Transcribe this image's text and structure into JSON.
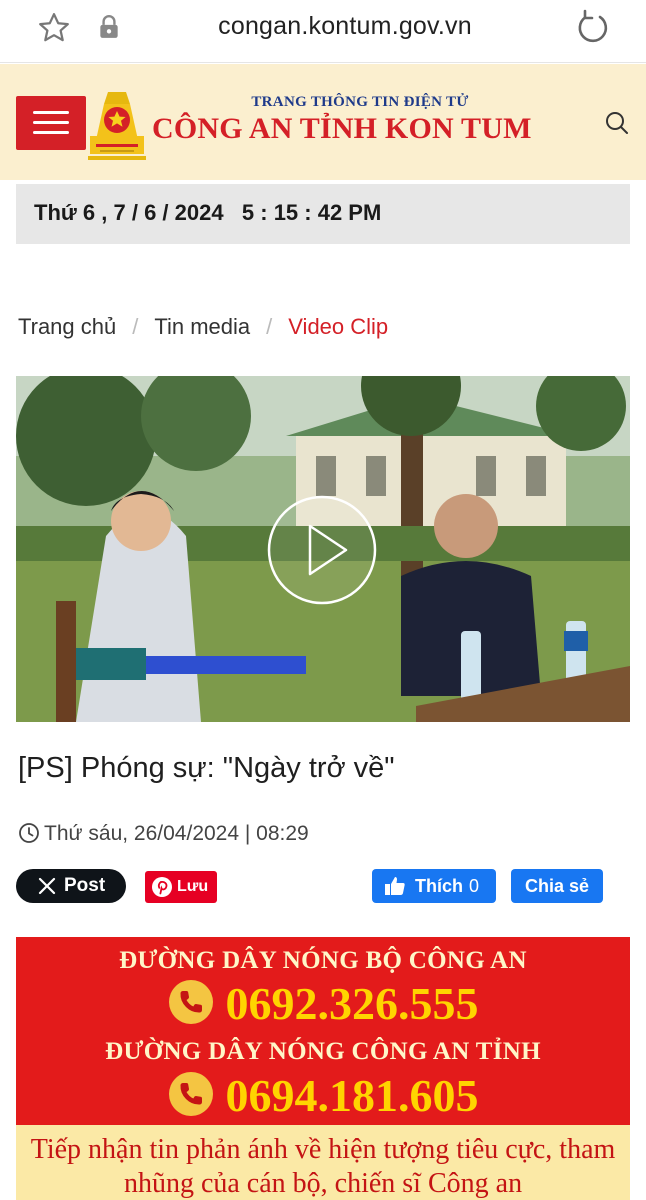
{
  "browser": {
    "url": "congan.kontum.gov.vn"
  },
  "header": {
    "subtitle": "TRANG THÔNG TIN ĐIỆN TỬ",
    "title": "CÔNG AN TỈNH KON TUM"
  },
  "datebar": {
    "datetime": "Thứ 6 , 7 / 6 / 2024   5 : 15 : 42 PM"
  },
  "breadcrumb": {
    "home": "Trang chủ",
    "section": "Tin media",
    "current": "Video Clip"
  },
  "article": {
    "title": "[PS] Phóng sự: \"Ngày trở về\"",
    "published": "Thứ sáu, 26/04/2024 | 08:29"
  },
  "social": {
    "x_post": "Post",
    "pinterest_save": "Lưu",
    "fb_like": "Thích",
    "fb_like_count": "0",
    "fb_share": "Chia sẻ"
  },
  "hotline": {
    "ministry_label": "ĐƯỜNG DÂY NÓNG BỘ CÔNG AN",
    "ministry_number": "0692.326.555",
    "province_label": "ĐƯỜNG DÂY NÓNG CÔNG AN TỈNH",
    "province_number": "0694.181.605",
    "notice": "Tiếp nhận tin phản ánh về hiện tượng tiêu cực, tham nhũng của cán bộ, chiến sĩ Công an"
  },
  "colors": {
    "brand_red": "#d42027",
    "header_bg": "#fbefcf",
    "facebook_blue": "#1877f2",
    "hotline_yellow": "#ffd400"
  }
}
